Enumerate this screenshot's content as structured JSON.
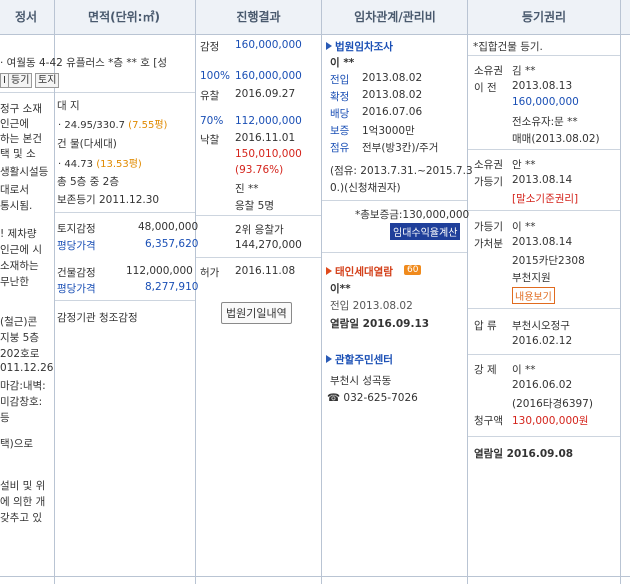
{
  "headers": {
    "col1": "정서",
    "col2": "면적(단위:㎡)",
    "col3": "진행결과",
    "col4": "임차관계/관리비",
    "col5": "등기권리"
  },
  "col1": {
    "addr": "· 여월동 4-42 유플러스 *층 ** 호 [성",
    "btn1": "I",
    "btn2": "등기",
    "btn3": "토지",
    "lines": [
      "정구 소재",
      "인근에",
      "하는 본건",
      "택 및 소",
      "생활시설등",
      "대로서",
      "통시됨.",
      "! 제차량",
      "인근에 시",
      "소재하는",
      "무난한",
      "(철근)콘",
      "지붕 5층",
      "202호로",
      "011.12.26",
      "마감:내벽:",
      "미감창호:",
      "등",
      "택)으로",
      "설비 및 위",
      "에 의한 개",
      "갖추고 있"
    ]
  },
  "col2": {
    "land_label": "대 지",
    "land_value": "· 24.95/330.7",
    "land_pyeong": "(7.55평)",
    "bldg_label": "건 물(다세대)",
    "bldg_value": "· 44.73",
    "bldg_pyeong": "(13.53평)",
    "floors": "총 5층 중 2층",
    "preserve": "보존등기 2011.12.30",
    "land_appr_label": "토지감정",
    "land_appr_value": "48,000,000",
    "land_avg_label": "평당가격",
    "land_avg_value": "6,357,620",
    "bldg_appr_label": "건물감정",
    "bldg_appr_value": "112,000,000",
    "bldg_avg_label": "평당가격",
    "bldg_avg_value": "8,277,910",
    "agency": "감정기관   청조감정"
  },
  "col3": {
    "appraisal_label": "감정",
    "appraisal_value": "160,000,000",
    "r1_pct": "100%",
    "r1_value": "160,000,000",
    "r1_label": "유찰",
    "r1_date": "2016.09.27",
    "r2_pct": "70%",
    "r2_value": "112,000,000",
    "win_label": "낙찰",
    "win_date": "2016.11.01",
    "win_price": "150,010,000",
    "win_ratio": "(93.76%)",
    "winner": "진 **",
    "bidders": "응찰 5명",
    "second": "2위 응찰가",
    "second_price": "144,270,000",
    "permit_label": "허가",
    "permit_date": "2016.11.08",
    "btn_court": "법원기일내역"
  },
  "col4": {
    "court_title": "법원임차조사",
    "name": "이 **",
    "move_label": "전입",
    "move_date": "2013.08.02",
    "fix_label": "확정",
    "fix_date": "2013.08.02",
    "dist_label": "배당",
    "dist_date": "2016.07.06",
    "dep_label": "보증",
    "dep_value": "1억3000만",
    "occ_label": "점유",
    "occ_value": "전부(방3칸)/주거",
    "period1": "(점유: 2013.7.31.~2015.7.3",
    "period2": "0.)(신청채권자)",
    "total": "*총보증금:130,000,000",
    "calc_btn": "임대수익율계산",
    "tenant_title": "태인세대열람",
    "tenant_badge": "60",
    "t_name": "이**",
    "t_move": "전입  2013.08.02",
    "t_view": "열람일 2016.09.13",
    "center_title": "관할주민센터",
    "center_name": "부천시 성곡동",
    "center_phone": "☎ 032-625-7026"
  },
  "col5": {
    "note": "*집합건물 등기.",
    "own1_label": "소유권",
    "own1_name": "김 **",
    "own1_sub": "이    전",
    "own1_date": "2013.08.13",
    "own1_price": "160,000,000",
    "own1_prev": "전소유자:문 **",
    "own1_trade": "매매(2013.08.02)",
    "own2_label": "소유권",
    "own2_name": "안 **",
    "own2_sub": "가등기",
    "own2_date": "2013.08.14",
    "own2_tag": "[말소기준권리]",
    "own3_label": "가등기",
    "own3_name": "이 **",
    "own3_sub": "가처분",
    "own3_date": "2013.08.14",
    "own3_case": "2015카단2308",
    "own3_court": "부천지원",
    "own3_btn": "내용보기",
    "seize_label": "압    류",
    "seize_name": "부천시오정구",
    "seize_date": "2016.02.12",
    "force_label": "강    제",
    "force_name": "이 **",
    "force_date": "2016.06.02",
    "force_case": "(2016타경6397)",
    "claim_label": "청구액",
    "claim_value": "130,000,000원",
    "view": "열람일 2016.09.08"
  }
}
